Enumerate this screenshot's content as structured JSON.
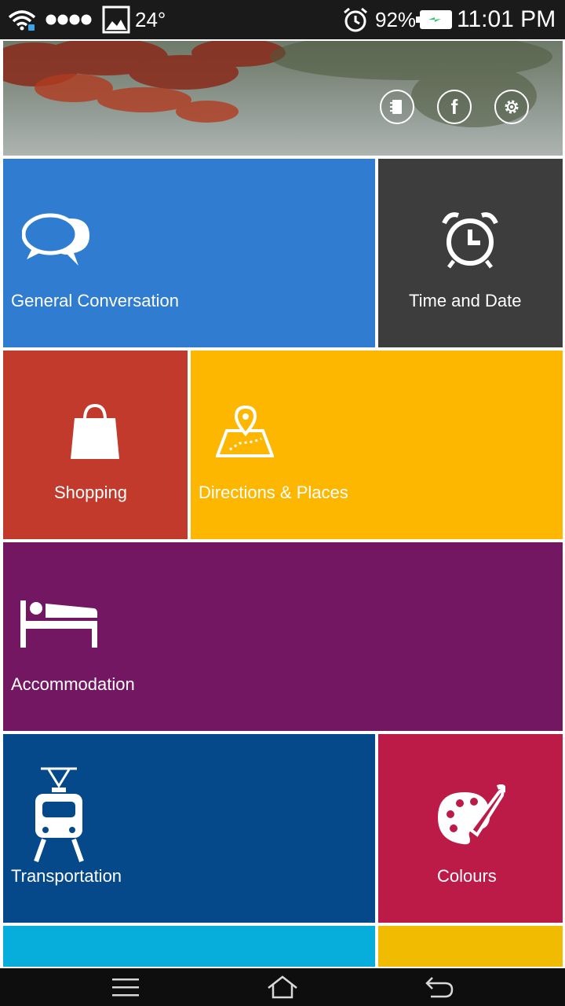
{
  "status_bar": {
    "temperature": "24°",
    "battery": "92%",
    "time": "11:01 PM"
  },
  "header": {
    "buttons": [
      {
        "icon": "contacts-book-icon"
      },
      {
        "icon": "facebook-icon",
        "glyph": "f"
      },
      {
        "icon": "settings-gear-icon"
      }
    ]
  },
  "tiles": [
    {
      "label": "General Conversation",
      "icon": "chat-bubbles-icon",
      "color": "#2f7cd0"
    },
    {
      "label": "Time and Date",
      "icon": "alarm-clock-icon",
      "color": "#3d3d3d"
    },
    {
      "label": "Shopping",
      "icon": "shopping-bag-icon",
      "color": "#c13a2b"
    },
    {
      "label": "Directions & Places",
      "icon": "map-pin-icon",
      "color": "#fdb700"
    },
    {
      "label": "Accommodation",
      "icon": "bed-icon",
      "color": "#731762"
    },
    {
      "label": "Transportation",
      "icon": "tram-icon",
      "color": "#05498b"
    },
    {
      "label": "Colours",
      "icon": "palette-icon",
      "color": "#bc1b48"
    },
    {
      "label": "",
      "color": "#08aedb"
    },
    {
      "label": "",
      "color": "#f0bb00"
    }
  ],
  "nav": {
    "buttons": [
      "menu-icon",
      "home-icon",
      "back-icon"
    ]
  }
}
